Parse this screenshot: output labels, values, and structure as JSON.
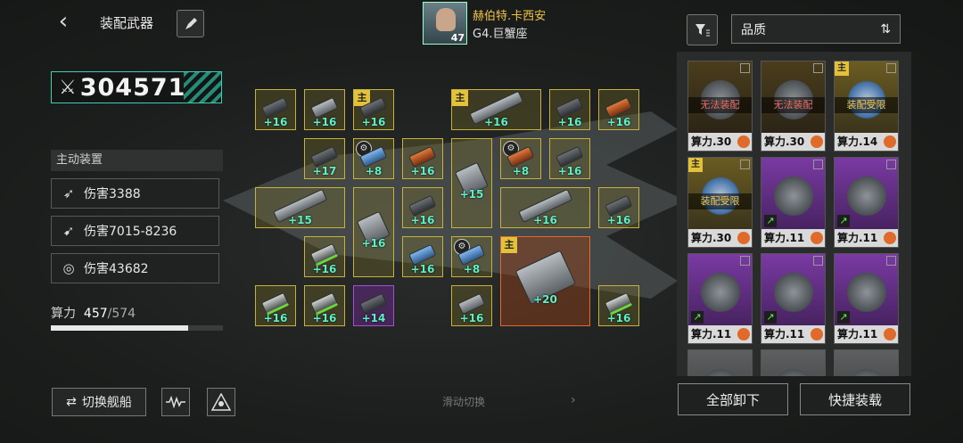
{
  "header": {
    "back_icon": "chevron-left-icon",
    "title": "装配武器",
    "player_name": "赫伯特.卡西安",
    "player_level": "47",
    "ship_rank": "G4.巨蟹座"
  },
  "power": {
    "value": "304571"
  },
  "active_devices": {
    "heading": "主动装置",
    "items": [
      {
        "icon": "missile-wave-icon",
        "label": "伤害3388"
      },
      {
        "icon": "rocket-icon",
        "label": "伤害7015-8236"
      },
      {
        "icon": "target-ring-icon",
        "label": "伤害43682"
      }
    ]
  },
  "capacity": {
    "label": "算力",
    "used": "457",
    "max": "/574",
    "fraction": 0.796
  },
  "bottom": {
    "switch_label": "切换舰船",
    "hint": "滑动切换"
  },
  "slots": [
    {
      "lv": "+16",
      "tag": ""
    },
    {
      "lv": "+16",
      "tag": ""
    },
    {
      "lv": "+16",
      "tag": "主"
    },
    {
      "lv": "+16",
      "tag": "主"
    },
    {
      "lv": "+16",
      "tag": ""
    },
    {
      "lv": "+16",
      "tag": ""
    },
    {
      "lv": "+17",
      "tag": ""
    },
    {
      "lv": "+8",
      "tag": ""
    },
    {
      "lv": "+16",
      "tag": ""
    },
    {
      "lv": "+15",
      "tag": ""
    },
    {
      "lv": "+8",
      "tag": ""
    },
    {
      "lv": "+16",
      "tag": ""
    },
    {
      "lv": "+15",
      "tag": ""
    },
    {
      "lv": "+16",
      "tag": ""
    },
    {
      "lv": "+16",
      "tag": ""
    },
    {
      "lv": "+16",
      "tag": ""
    },
    {
      "lv": "+16",
      "tag": ""
    },
    {
      "lv": "+16",
      "tag": ""
    },
    {
      "lv": "+16",
      "tag": ""
    },
    {
      "lv": "+8",
      "tag": ""
    },
    {
      "lv": "+20",
      "tag": "主"
    },
    {
      "lv": "+16",
      "tag": ""
    },
    {
      "lv": "+16",
      "tag": ""
    },
    {
      "lv": "+14",
      "tag": ""
    },
    {
      "lv": "+16",
      "tag": ""
    },
    {
      "lv": "+16",
      "tag": ""
    }
  ],
  "inventory": {
    "sort_label": "品质",
    "items": [
      {
        "tag": "",
        "warn": "无法装配",
        "cost": "算力.30"
      },
      {
        "tag": "",
        "warn": "无法装配",
        "cost": "算力.30"
      },
      {
        "tag": "主",
        "warn": "装配受限",
        "cost": "算力.14"
      },
      {
        "tag": "主",
        "warn": "装配受限",
        "cost": "算力.30"
      },
      {
        "tag": "",
        "warn": "",
        "cost": "算力.11"
      },
      {
        "tag": "",
        "warn": "",
        "cost": "算力.11"
      },
      {
        "tag": "",
        "warn": "",
        "cost": "算力.11"
      },
      {
        "tag": "",
        "warn": "",
        "cost": "算力.11"
      },
      {
        "tag": "",
        "warn": "",
        "cost": "算力.11"
      }
    ],
    "unload_all": "全部卸下",
    "quick_equip": "快捷装载"
  }
}
